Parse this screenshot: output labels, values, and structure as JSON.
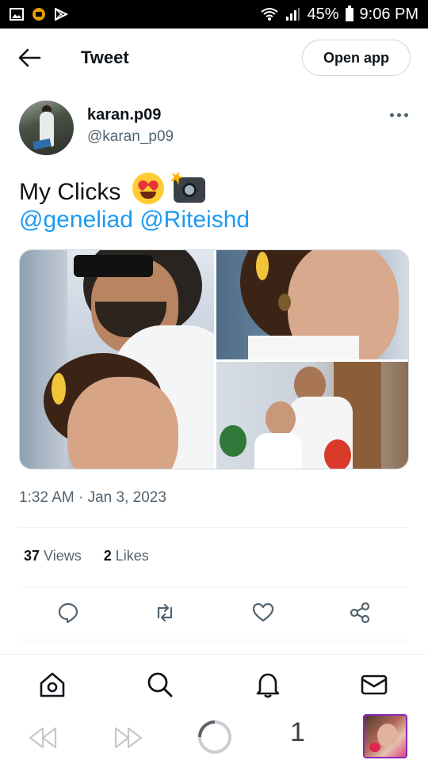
{
  "status_bar": {
    "battery_percent": "45%",
    "time": "9:06 PM"
  },
  "header": {
    "title": "Tweet",
    "open_app_label": "Open app"
  },
  "tweet": {
    "author_name": "karan.p09",
    "author_handle": "@karan_p09",
    "text": "My Clicks",
    "emojis": [
      "heart-eyes-emoji",
      "camera-flash-emoji"
    ],
    "mentions_line": "@geneliad @Riteishd",
    "timestamp": "1:32 AM · Jan 3, 2023",
    "stats": {
      "views_count": "37",
      "views_label": "Views",
      "likes_count": "2",
      "likes_label": "Likes"
    }
  },
  "actions": [
    "reply-icon",
    "retweet-icon",
    "like-icon",
    "share-icon"
  ],
  "bottom_nav": [
    "home-icon",
    "search-icon",
    "notifications-icon",
    "messages-icon"
  ],
  "system_nav": {
    "tab_count": "1"
  },
  "colors": {
    "link": "#1d9bf0",
    "text": "#0f1419",
    "muted": "#536471",
    "border": "#cfd9de"
  }
}
